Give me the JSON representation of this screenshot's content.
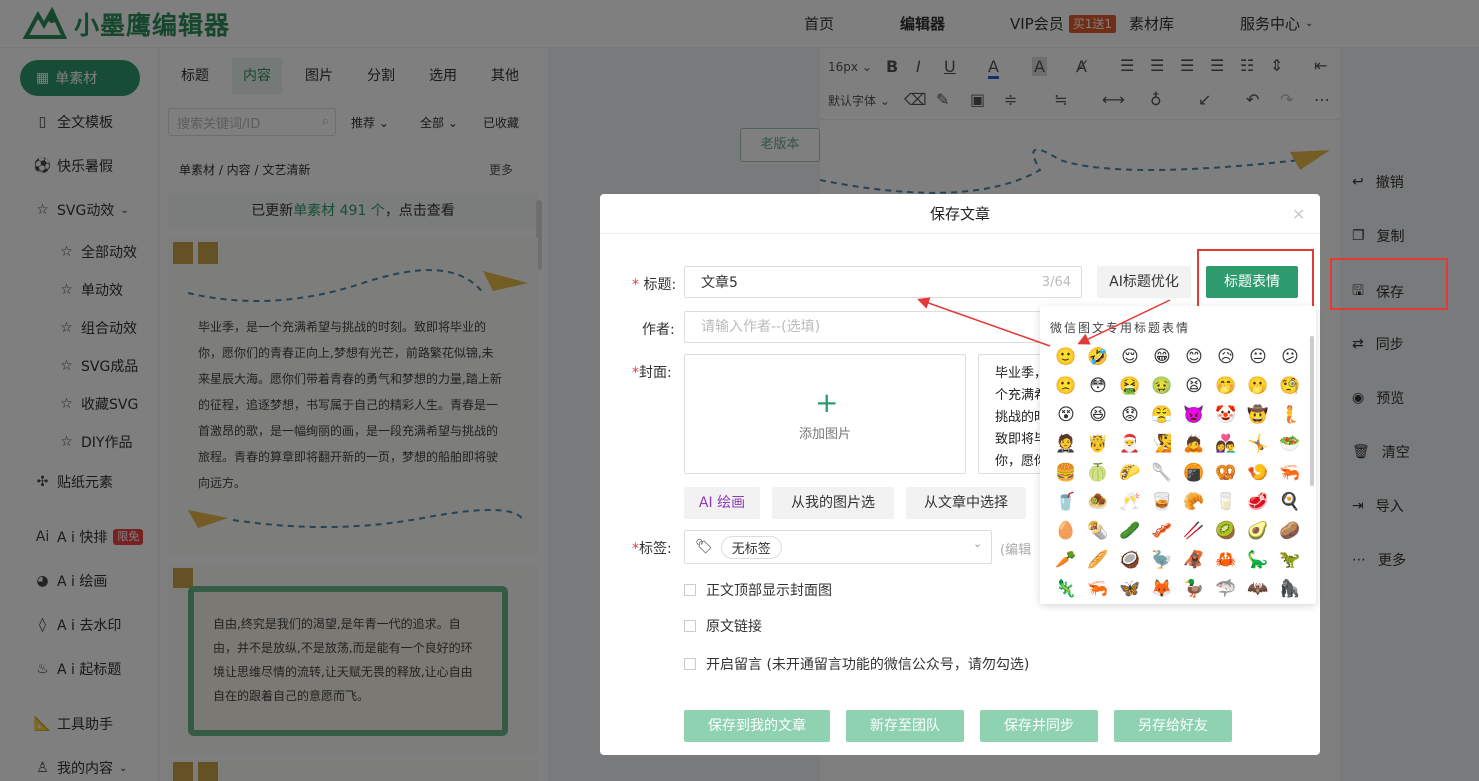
{
  "header": {
    "logo_text": "小墨鹰编辑器",
    "nav": [
      "首页",
      "编辑器",
      "VIP会员",
      "素材库",
      "服务中心"
    ],
    "vip_badge": "买1送1"
  },
  "sidebar": {
    "active": "单素材",
    "items": [
      "全文模板",
      "快乐暑假",
      "SVG动效",
      "全部动效",
      "单动效",
      "组合动效",
      "SVG成品",
      "收藏SVG",
      "DIY作品",
      "贴纸元素",
      "A i 快排",
      "A i 绘画",
      "A i 去水印",
      "A i 起标题",
      "工具助手",
      "我的内容"
    ],
    "free_badge": "限免"
  },
  "panel": {
    "tabs": [
      "标题",
      "内容",
      "图片",
      "分割",
      "选用",
      "其他"
    ],
    "search_placeholder": "搜索关键词/ID",
    "filters": [
      "推荐",
      "全部",
      "已收藏"
    ],
    "breadcrumb": "单素材 / 内容 / 文艺清新",
    "more": "更多",
    "update_prefix": "已更新",
    "update_link": "单素材 491 个",
    "update_suffix": "，点击查看",
    "card1_text": "毕业季，是一个充满希望与挑战的时刻。致即将毕业的你，愿你们的青春正向上,梦想有光芒，前路繁花似锦,未来星辰大海。愿你们带着青春的勇气和梦想的力量,踏上新的征程，追逐梦想，书写属于自己的精彩人生。青春是一首激昂的歌，是一幅绚丽的画，是一段充满希望与挑战的旅程。青春的算章即将翻开新的一页，梦想的船舶即将驶向远方。",
    "card2_text": "自由,终究是我们的渴望,是年青一代的追求。自由，并不是放纵,不是放荡,而是能有一个良好的环境让思维尽情的流转,让天赋无畏的释放,让心自由自在的跟着自己的意愿而飞。"
  },
  "editor": {
    "font_size": "16px",
    "font_family": "默认字体",
    "old_version": "老版本"
  },
  "right_rail": [
    "撤销",
    "复制",
    "保存",
    "同步",
    "预览",
    "清空",
    "导入",
    "更多"
  ],
  "dialog": {
    "title": "保存文章",
    "title_label": "标题:",
    "title_value": "文章5",
    "title_count": "3/64",
    "ai_optimize": "AI标题优化",
    "emoji_button": "标题表情",
    "author_label": "作者:",
    "author_placeholder": "请输入作者--(选填)",
    "cover_label": "封面:",
    "add_image": "添加图片",
    "cover_desc": "毕业季，是一个充满希望与挑战的时刻。致即将毕业的你，愿你们的青春正向上,梦想有光芒，前路繁花似锦,未来星辰大海。愿你们带着青春的勇气和梦想的力量",
    "cover_buttons": [
      "AI 绘画",
      "从我的图片选",
      "从文章中选择"
    ],
    "tag_label": "标签:",
    "tag_chip": "无标签",
    "tag_edit": "(编辑",
    "checkboxes": [
      "正文顶部显示封面图",
      "原文链接",
      "开启留言 (未开通留言功能的微信公众号，请勿勾选)"
    ],
    "footer_buttons": [
      "保存到我的文章",
      "新存至团队",
      "保存并同步",
      "另存给好友"
    ]
  },
  "emoji_popup": {
    "title": "微信图文专用标题表情",
    "emojis": [
      "🙂",
      "🤣",
      "😌",
      "😁",
      "😊",
      "😥",
      "😐",
      "😕",
      "🙁",
      "😳",
      "🤮",
      "🤢",
      "😫",
      "🤭",
      "🫢",
      "🧐",
      "😵",
      "😆",
      "😟",
      "😤",
      "👿",
      "🤡",
      "🤠",
      "🧜",
      "🤵",
      "🤴",
      "🎅",
      "🧏",
      "🙇",
      "👩‍❤️‍👨",
      "🤸",
      "🥗",
      "🍔",
      "🍈",
      "🌮",
      "🥄",
      "🍘",
      "🥨",
      "🍤",
      "🦐",
      "🥤",
      "🧆",
      "🥂",
      "🥃",
      "🥐",
      "🥛",
      "🥩",
      "🍳",
      "🥚",
      "🌯",
      "🥒",
      "🥓",
      "🥢",
      "🥝",
      "🥑",
      "🥔",
      "🥕",
      "🥖",
      "🥥",
      "🦤",
      "🦧",
      "🦀",
      "🦕",
      "🦖",
      "🦎",
      "🦐",
      "🦋",
      "🦊",
      "🦆",
      "🦈",
      "🦇",
      "🦍"
    ]
  },
  "colors": {
    "brand_green": "#2e9b6c",
    "highlight_red": "#e53935"
  }
}
